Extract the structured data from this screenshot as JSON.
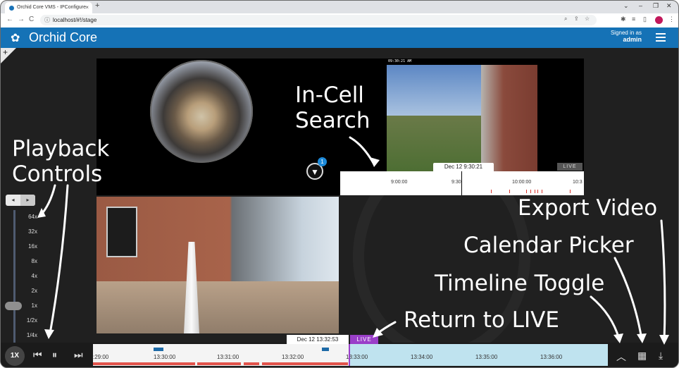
{
  "browser": {
    "tab_title": "Orchid Core VMS - IPConfigure",
    "tab_close": "×",
    "new_tab": "+",
    "url": "localhost/#!/stage",
    "nav_back": "←",
    "nav_forward": "→",
    "nav_reload": "C"
  },
  "app": {
    "brand": "Orchid Core",
    "signed_in_label": "Signed in as",
    "username": "admin",
    "colors": {
      "header": "#1572b6",
      "live": "#9a3fc9",
      "future": "#bfe3ef"
    }
  },
  "stage": {
    "add_label": "+",
    "search_badge": "1",
    "cam2_timestamp": "09:30:21 AM",
    "cam2_live": "LIVE",
    "cam2_date": "Dec 12 9:30:21",
    "cam2_ticks": [
      "9:00:00",
      "9:30",
      "10:00:00",
      "10:3"
    ]
  },
  "playback": {
    "speeds": [
      "64x",
      "32x",
      "16x",
      "8x",
      "4x",
      "2x",
      "1x",
      "1/2x",
      "1/4x"
    ],
    "current_speed": "1X",
    "prev_label": "◂",
    "next_label": "▸"
  },
  "timeline": {
    "date": "Dec 12 13:32:53",
    "live_label": "LIVE",
    "ticks": [
      ":29:00",
      "13:30:00",
      "13:31:00",
      "13:32:00",
      "13:33:00",
      "13:34:00",
      "13:35:00",
      "13:36:00"
    ]
  },
  "annotations": {
    "in_cell_search": "In-Cell\nSearch",
    "playback_controls": "Playback\nControls",
    "export_video": "Export Video",
    "calendar_picker": "Calendar Picker",
    "timeline_toggle": "Timeline Toggle",
    "return_to_live": "Return to LIVE"
  }
}
